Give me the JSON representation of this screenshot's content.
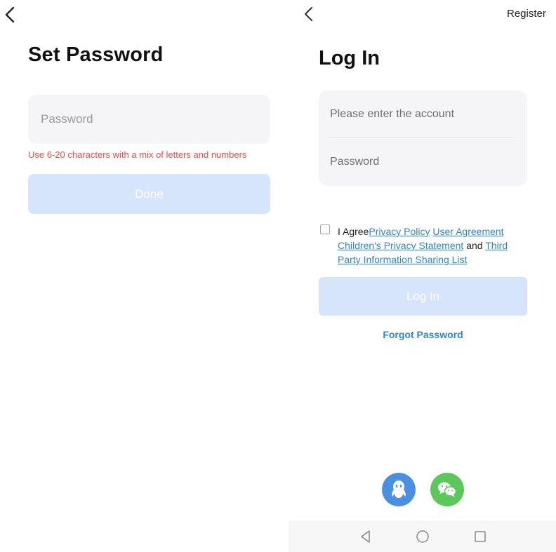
{
  "left_screen": {
    "title": "Set Password",
    "password_placeholder": "Password",
    "error_text": "Use 6-20 characters with a mix of letters and numbers",
    "done_label": "Done"
  },
  "right_screen": {
    "register_label": "Register",
    "title": "Log In",
    "account_placeholder": "Please enter the account",
    "password_placeholder": "Password",
    "agreement": {
      "prefix": "I Agree",
      "privacy_policy": "Privacy Policy",
      "user_agreement": "User Agreement",
      "children_privacy": "Children's Privacy Statement",
      "and": "and",
      "third_party": "Third Party Information Sharing List"
    },
    "login_label": "Log In",
    "forgot_label": "Forgot Password",
    "social": [
      {
        "icon": "qq-icon",
        "color": "#4a90e2"
      },
      {
        "icon": "wechat-icon",
        "color": "#5ac85a"
      }
    ]
  },
  "colors": {
    "accent": "#2f86c9",
    "error": "#f04848",
    "disabled_button": "#d6e5fc",
    "input_background": "#f5f5f7"
  },
  "nav_bar": {
    "icons": [
      "back-triangle-icon",
      "home-circle-icon",
      "recents-square-icon"
    ]
  }
}
